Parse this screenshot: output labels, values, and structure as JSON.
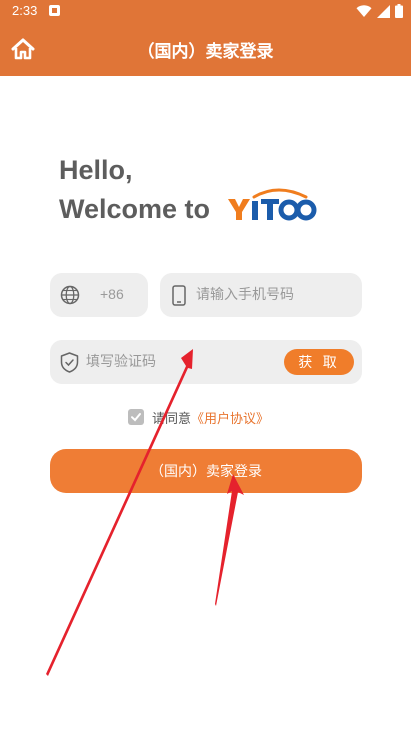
{
  "status_bar": {
    "time": "2:33",
    "icons": [
      "notification-icon",
      "wifi-icon",
      "signal-icon",
      "battery-icon"
    ]
  },
  "header": {
    "title": "（国内）卖家登录",
    "home_icon": "home-icon"
  },
  "greeting": {
    "line1": "Hello,",
    "line2": "Welcome to"
  },
  "logo": {
    "text": "YITOO",
    "colors": {
      "primary": "#f07d1e",
      "secondary": "#1b5cab"
    }
  },
  "form": {
    "country_code": "+86",
    "phone_placeholder": "请输入手机号码",
    "code_placeholder": "填写验证码",
    "get_code_label": "获 取"
  },
  "agreement": {
    "checked": true,
    "text": "请同意",
    "link": "《用户协议》"
  },
  "login_button": {
    "label": "（国内）卖家登录"
  },
  "theme": {
    "header_bg": "#e07537",
    "accent": "#ef7d35",
    "field_bg": "#eeeeee",
    "annotation_arrow": "#e5222d"
  }
}
